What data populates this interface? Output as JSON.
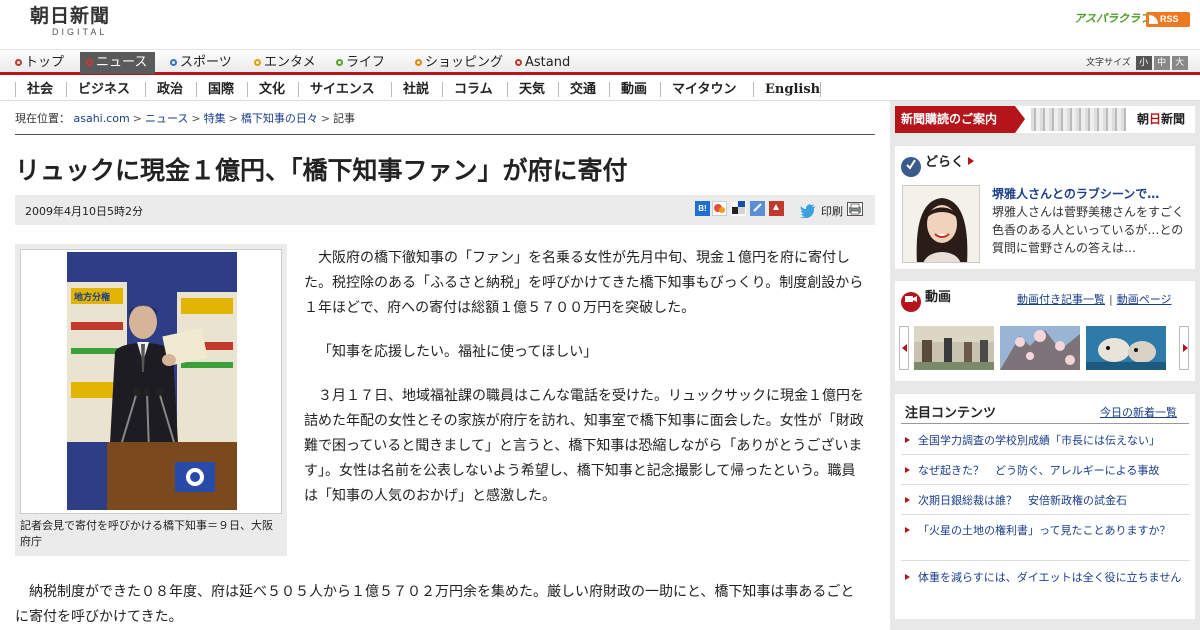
{
  "header": {
    "logo_main": "朝日新聞",
    "logo_sub": "DIGITAL",
    "asparaclub": "アスパラクラブ",
    "rss": "RSS"
  },
  "mainnav": {
    "items": [
      {
        "label": "トップ",
        "color": "#c0392b"
      },
      {
        "label": "ニュース",
        "color": "#c33333"
      },
      {
        "label": "スポーツ",
        "color": "#3a6fc4"
      },
      {
        "label": "エンタメ",
        "color": "#d9a400"
      },
      {
        "label": "ライフ",
        "color": "#5aa02c"
      },
      {
        "label": "ショッピング",
        "color": "#e08a00"
      },
      {
        "label": "Astand",
        "color": "#c0392b"
      }
    ],
    "fontsize_label": "文字サイズ",
    "fontsize_small": "小",
    "fontsize_medium": "中",
    "fontsize_large": "大"
  },
  "subnav": {
    "items": [
      "社会",
      "ビジネス",
      "政治",
      "国際",
      "文化",
      "サイエンス",
      "社説",
      "コラム",
      "天気",
      "交通",
      "動画",
      "マイタウン",
      "English"
    ]
  },
  "breadcrumb": {
    "label": "現在位置：",
    "items": [
      "asahi.com",
      "ニュース",
      "特集",
      "橋下知事の日々"
    ],
    "current": "記事"
  },
  "article": {
    "headline": "リュックに現金１億円、「橋下知事ファン」が府に寄付",
    "date": "2009年4月10日5時2分",
    "print_label": "印刷",
    "photo_caption": "記者会見で寄付を呼びかける橋下知事＝９日、大阪府庁",
    "photo_sign": "地方分権",
    "paragraphs": [
      "大阪府の橋下徹知事の「ファン」を名乗る女性が先月中旬、現金１億円を府に寄付した。税控除のある「ふるさと納税」を呼びかけてきた橋下知事もびっくり。制度創設から１年ほどで、府への寄付は総額１億５７００万円を突破した。",
      "「知事を応援したい。福祉に使ってほしい」",
      "３月１７日、地域福祉課の職員はこんな電話を受けた。リュックサックに現金１億円を詰めた年配の女性とその家族が府庁を訪れ、知事室で橋下知事に面会した。女性が「財政難で困っていると聞きまして」と言うと、橋下知事は恐縮しながら「ありがとうございます」。女性は名前を公表しないよう希望し、橋下知事と記念撮影して帰ったという。職員は「知事の人気のおかげ」と感激した。"
    ],
    "bottom_paragraph": "納税制度ができた０８年度、府は延べ５０５人から１億５７０２万円余を集めた。厳しい府財政の一助にと、橋下知事は事あるごとに寄付を呼びかけてきた。"
  },
  "sidebar": {
    "subscribe_label": "新聞購読のご案内",
    "subscribe_brand_pre": "朝",
    "subscribe_brand_mid": "日",
    "subscribe_brand_post": "新聞",
    "doraku": {
      "title": "どらく",
      "item_title": "堺雅人さんとのラブシーンで…",
      "item_text": "堺雅人さんは菅野美穂さんをすごく色香のある人といっているが…との質問に菅野さんの答えは…"
    },
    "douga": {
      "title": "動画",
      "link1": "動画付き記事一覧",
      "link2": "動画ページ"
    },
    "chumoku": {
      "title": "注目コンテンツ",
      "link": "今日の新着一覧",
      "items": [
        "全国学力調査の学校別成績「市長には伝えない」",
        "なぜ起きた？　どう防ぐ、アレルギーによる事故",
        "次期日銀総裁は誰？　安倍新政権の試金石",
        "「火星の土地の権利書」って見たことありますか？",
        "体重を減らすには、ダイエットは全く役に立ちません"
      ]
    }
  },
  "colors": {
    "brand_red": "#b4141a",
    "link_blue": "#1a3e8a",
    "nav_active": "#5a5a5a",
    "sidebar_bg": "#e8e8e8"
  }
}
